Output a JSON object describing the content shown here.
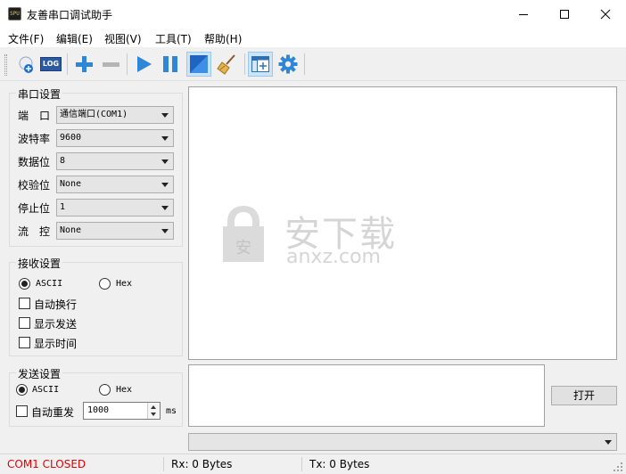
{
  "window": {
    "title": "友善串口调试助手",
    "app_icon_text": "SPU",
    "minimize_icon": "minimize-icon",
    "maximize_icon": "maximize-icon",
    "close_icon": "close-icon"
  },
  "menu": [
    "文件(F)",
    "编辑(E)",
    "视图(V)",
    "工具(T)",
    "帮助(H)"
  ],
  "toolbar": {
    "log_label": "LOG",
    "icons": [
      "new-session-icon",
      "log-icon",
      "add-icon",
      "remove-icon",
      "play-icon",
      "pause-icon",
      "display-toggle-icon",
      "broom-icon",
      "window-add-icon",
      "gear-icon"
    ]
  },
  "serial": {
    "title": "串口设置",
    "port_label": "端　口",
    "port_value": "通信端口(COM1)",
    "baud_label": "波特率",
    "baud_value": "9600",
    "databits_label": "数据位",
    "databits_value": "8",
    "parity_label": "校验位",
    "parity_value": "None",
    "stopbits_label": "停止位",
    "stopbits_value": "1",
    "flow_label": "流　控",
    "flow_value": "None"
  },
  "receive": {
    "title": "接收设置",
    "ascii_label": "ASCII",
    "hex_label": "Hex",
    "selected": "ASCII",
    "auto_newline_label": "自动换行",
    "show_send_label": "显示发送",
    "show_time_label": "显示时间"
  },
  "send": {
    "title": "发送设置",
    "ascii_label": "ASCII",
    "hex_label": "Hex",
    "selected": "ASCII",
    "auto_resend_label": "自动重发",
    "interval_value": "1000",
    "interval_unit": "ms",
    "open_button": "打开"
  },
  "status": {
    "port_state": "COM1 CLOSED",
    "rx": "Rx: 0 Bytes",
    "tx": "Tx: 0 Bytes",
    "port_state_color": "#e00000"
  },
  "watermark": {
    "name": "安下载",
    "domain": "anxz.com"
  }
}
